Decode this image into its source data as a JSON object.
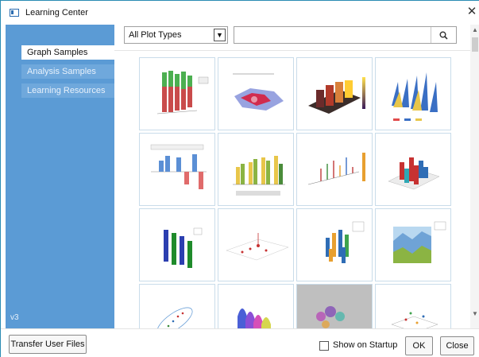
{
  "window": {
    "title": "Learning Center",
    "icon": "app-window-icon"
  },
  "sidebar": {
    "items": [
      {
        "label": "Graph Samples",
        "active": true
      },
      {
        "label": "Analysis Samples",
        "active": false
      },
      {
        "label": "Learning Resources",
        "active": false
      }
    ],
    "version": "v3"
  },
  "filter": {
    "selected": "All Plot Types",
    "search_value": ""
  },
  "thumbnails": [
    {
      "name": "3d-bar-green-red"
    },
    {
      "name": "3d-surface-map"
    },
    {
      "name": "3d-bar-surface"
    },
    {
      "name": "3d-waterfall"
    },
    {
      "name": "3d-stacked-bar"
    },
    {
      "name": "3d-grouped-bar"
    },
    {
      "name": "3d-scatter-sticks"
    },
    {
      "name": "3d-cylinders"
    },
    {
      "name": "3d-ribbon-bars"
    },
    {
      "name": "3d-scatter-drop"
    },
    {
      "name": "3d-cone-columns"
    },
    {
      "name": "3d-area-wall"
    },
    {
      "name": "3d-ellipse-scatter"
    },
    {
      "name": "3d-ribbons"
    },
    {
      "name": "3d-point-cloud"
    },
    {
      "name": "3d-vector-scatter"
    }
  ],
  "footer": {
    "transfer_label": "Transfer User Files",
    "startup_label": "Show on Startup",
    "ok_label": "OK",
    "close_label": "Close"
  },
  "colors": {
    "sidebar": "#5b9bd5",
    "accent": "#2a8bb3"
  }
}
